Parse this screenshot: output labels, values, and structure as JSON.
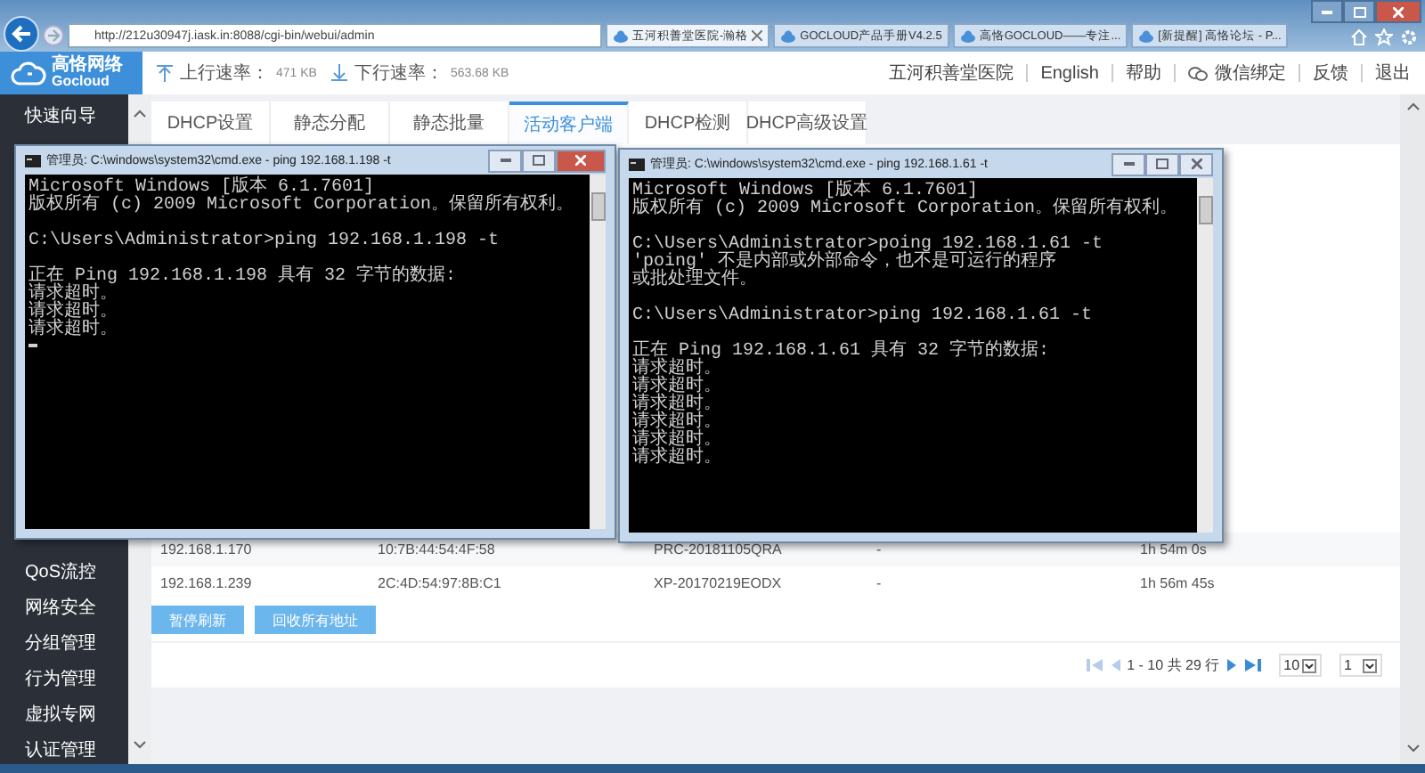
{
  "browser": {
    "address": "http://212u30947j.iask.in:8088/cgi-bin/webui/admin",
    "tabs": [
      {
        "label": "五河积善堂医院-瀚格",
        "selected": true,
        "closable": true
      },
      {
        "label": "GOCLOUD产品手册V4.2.5",
        "selected": false,
        "closable": false
      },
      {
        "label": "高恪GOCLOUD——专注...",
        "selected": false,
        "closable": false
      },
      {
        "label": "[新提醒] 高恪论坛 - P...",
        "selected": false,
        "closable": false
      }
    ]
  },
  "logo": {
    "name": "高恪网络",
    "sub": "Gocloud"
  },
  "speeds": [
    {
      "kind": "up",
      "label": "上行速率：",
      "value": "471 KB"
    },
    {
      "kind": "down",
      "label": "下行速率：",
      "value": "563.68 KB"
    }
  ],
  "header_links": [
    {
      "label": "五河积善堂医院",
      "kind": "text"
    },
    {
      "label": "English",
      "kind": "text"
    },
    {
      "label": "帮助",
      "kind": "text"
    },
    {
      "label": "微信绑定",
      "kind": "wechat"
    },
    {
      "label": "反馈",
      "kind": "text"
    },
    {
      "label": "退出",
      "kind": "text"
    }
  ],
  "sidebar": {
    "top_items": [
      "快速向导"
    ],
    "bottom_items": [
      "QoS流控",
      "网络安全",
      "分组管理",
      "行为管理",
      "虚拟专网",
      "认证管理"
    ]
  },
  "tabs": [
    {
      "label": "DHCP设置",
      "selected": false
    },
    {
      "label": "静态分配",
      "selected": false
    },
    {
      "label": "静态批量",
      "selected": false
    },
    {
      "label": "活动客户端",
      "selected": true
    },
    {
      "label": "DHCP检测",
      "selected": false
    },
    {
      "label": "DHCP高级设置",
      "selected": false
    }
  ],
  "table": {
    "rows": [
      [
        "192.168.1.170",
        "10:7B:44:54:4F:58",
        "PRC-20181105QRA",
        "-",
        "1h 54m 0s"
      ],
      [
        "192.168.1.239",
        "2C:4D:54:97:8B:C1",
        "XP-20170219EODX",
        "-",
        "1h 56m 45s"
      ]
    ]
  },
  "buttons": [
    "暂停刷新",
    "回收所有地址"
  ],
  "pager": {
    "summary": "1 - 10 共 29 行",
    "page_size": "10",
    "page": "1"
  },
  "consoles": [
    {
      "title": "管理员: C:\\windows\\system32\\cmd.exe - ping  192.168.1.198 -t",
      "cursor": true,
      "blocks": [
        [
          "Microsoft Windows [版本 6.1.7601]",
          "版权所有 (c) 2009 Microsoft Corporation。保留所有权利。"
        ],
        [
          "C:\\Users\\Administrator>ping 192.168.1.198 -t"
        ],
        [
          "正在 Ping 192.168.1.198 具有 32 字节的数据:",
          "请求超时。",
          "请求超时。",
          "请求超时。"
        ]
      ]
    },
    {
      "title": "管理员: C:\\windows\\system32\\cmd.exe - ping  192.168.1.61 -t",
      "cursor": false,
      "blocks": [
        [
          "Microsoft Windows [版本 6.1.7601]",
          "版权所有 (c) 2009 Microsoft Corporation。保留所有权利。"
        ],
        [
          "C:\\Users\\Administrator>poing 192.168.1.61 -t",
          "'poing' 不是内部或外部命令，也不是可运行的程序",
          "或批处理文件。"
        ],
        [
          "C:\\Users\\Administrator>ping 192.168.1.61 -t"
        ],
        [
          "正在 Ping 192.168.1.61 具有 32 字节的数据:",
          "请求超时。",
          "请求超时。",
          "请求超时。",
          "请求超时。",
          "请求超时。",
          "请求超时。"
        ]
      ]
    }
  ]
}
